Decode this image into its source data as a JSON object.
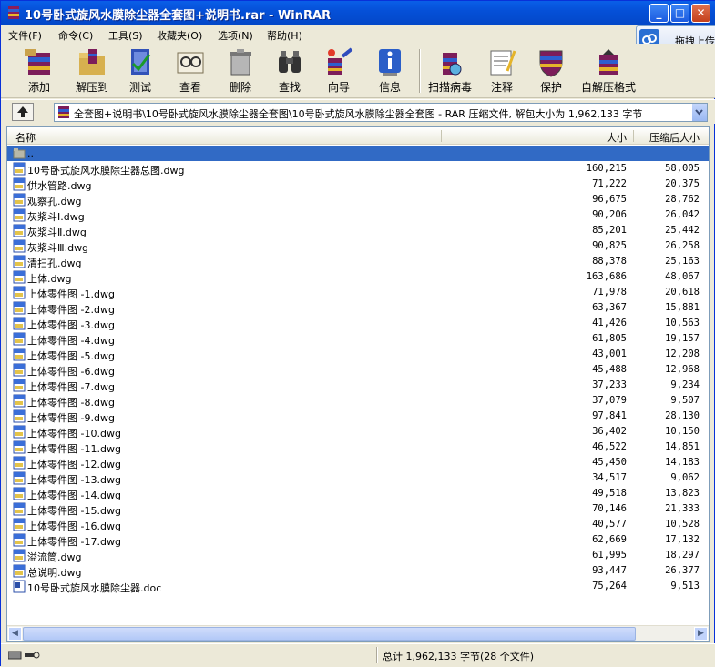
{
  "window": {
    "title": "10号卧式旋风水膜除尘器全套图+说明书.rar - WinRAR",
    "minimize_glyph": "_",
    "maximize_glyph": "□",
    "close_glyph": "✕"
  },
  "menu": [
    "文件(F)",
    "命令(C)",
    "工具(S)",
    "收藏夹(O)",
    "选项(N)",
    "帮助(H)"
  ],
  "upload": {
    "label": "拖拽上传"
  },
  "toolbar": [
    {
      "label": "添加",
      "icon": "add-icon"
    },
    {
      "label": "解压到",
      "icon": "extract-to-icon"
    },
    {
      "label": "测试",
      "icon": "test-icon"
    },
    {
      "label": "查看",
      "icon": "view-icon"
    },
    {
      "label": "删除",
      "icon": "delete-icon"
    },
    {
      "label": "查找",
      "icon": "find-icon"
    },
    {
      "label": "向导",
      "icon": "wizard-icon"
    },
    {
      "label": "信息",
      "icon": "info-icon"
    },
    {
      "label": "扫描病毒",
      "icon": "virus-scan-icon"
    },
    {
      "label": "注释",
      "icon": "comment-icon"
    },
    {
      "label": "保护",
      "icon": "protect-icon"
    },
    {
      "label": "自解压格式",
      "icon": "sfx-icon"
    }
  ],
  "address": {
    "path": "全套图+说明书\\10号卧式旋风水膜除尘器全套图\\10号卧式旋风水膜除尘器全套图 - RAR 压缩文件, 解包大小为 1,962,133 字节"
  },
  "columns": {
    "name": "名称",
    "size": "大小",
    "packed": "压缩后大小"
  },
  "files": [
    {
      "name": "..",
      "size": "",
      "packed": "",
      "type": "folder",
      "selected": true
    },
    {
      "name": "10号卧式旋风水膜除尘器总图.dwg",
      "size": "160,215",
      "packed": "58,005",
      "type": "dwg"
    },
    {
      "name": "供水管路.dwg",
      "size": "71,222",
      "packed": "20,375",
      "type": "dwg"
    },
    {
      "name": "观察孔.dwg",
      "size": "96,675",
      "packed": "28,762",
      "type": "dwg"
    },
    {
      "name": "灰浆斗Ⅰ.dwg",
      "size": "90,206",
      "packed": "26,042",
      "type": "dwg"
    },
    {
      "name": "灰浆斗Ⅱ.dwg",
      "size": "85,201",
      "packed": "25,442",
      "type": "dwg"
    },
    {
      "name": "灰浆斗Ⅲ.dwg",
      "size": "90,825",
      "packed": "26,258",
      "type": "dwg"
    },
    {
      "name": "清扫孔.dwg",
      "size": "88,378",
      "packed": "25,163",
      "type": "dwg"
    },
    {
      "name": "上体.dwg",
      "size": "163,686",
      "packed": "48,067",
      "type": "dwg"
    },
    {
      "name": "上体零件图 -1.dwg",
      "size": "71,978",
      "packed": "20,618",
      "type": "dwg"
    },
    {
      "name": "上体零件图 -2.dwg",
      "size": "63,367",
      "packed": "15,881",
      "type": "dwg"
    },
    {
      "name": "上体零件图 -3.dwg",
      "size": "41,426",
      "packed": "10,563",
      "type": "dwg"
    },
    {
      "name": "上体零件图 -4.dwg",
      "size": "61,805",
      "packed": "19,157",
      "type": "dwg"
    },
    {
      "name": "上体零件图 -5.dwg",
      "size": "43,001",
      "packed": "12,208",
      "type": "dwg"
    },
    {
      "name": "上体零件图 -6.dwg",
      "size": "45,488",
      "packed": "12,968",
      "type": "dwg"
    },
    {
      "name": "上体零件图 -7.dwg",
      "size": "37,233",
      "packed": "9,234",
      "type": "dwg"
    },
    {
      "name": "上体零件图 -8.dwg",
      "size": "37,079",
      "packed": "9,507",
      "type": "dwg"
    },
    {
      "name": "上体零件图 -9.dwg",
      "size": "97,841",
      "packed": "28,130",
      "type": "dwg"
    },
    {
      "name": "上体零件图 -10.dwg",
      "size": "36,402",
      "packed": "10,150",
      "type": "dwg"
    },
    {
      "name": "上体零件图 -11.dwg",
      "size": "46,522",
      "packed": "14,851",
      "type": "dwg"
    },
    {
      "name": "上体零件图 -12.dwg",
      "size": "45,450",
      "packed": "14,183",
      "type": "dwg"
    },
    {
      "name": "上体零件图 -13.dwg",
      "size": "34,517",
      "packed": "9,062",
      "type": "dwg"
    },
    {
      "name": "上体零件图 -14.dwg",
      "size": "49,518",
      "packed": "13,823",
      "type": "dwg"
    },
    {
      "name": "上体零件图 -15.dwg",
      "size": "70,146",
      "packed": "21,333",
      "type": "dwg"
    },
    {
      "name": "上体零件图 -16.dwg",
      "size": "40,577",
      "packed": "10,528",
      "type": "dwg"
    },
    {
      "name": "上体零件图 -17.dwg",
      "size": "62,669",
      "packed": "17,132",
      "type": "dwg"
    },
    {
      "name": "溢流筒.dwg",
      "size": "61,995",
      "packed": "18,297",
      "type": "dwg"
    },
    {
      "name": "总说明.dwg",
      "size": "93,447",
      "packed": "26,377",
      "type": "dwg"
    },
    {
      "name": "10号卧式旋风水膜除尘器.doc",
      "size": "75,264",
      "packed": "9,513",
      "type": "doc"
    }
  ],
  "status": {
    "text": "总计 1,962,133 字节(28 个文件)"
  },
  "colors": {
    "titlebar": "#0550d8",
    "selection": "#316ac5",
    "chrome": "#ece9d8"
  }
}
